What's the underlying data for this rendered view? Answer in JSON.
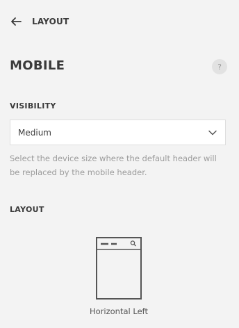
{
  "nav": {
    "back_icon": "arrow-left-icon",
    "back_label": "LAYOUT"
  },
  "section": {
    "title": "MOBILE",
    "help_symbol": "?"
  },
  "visibility": {
    "label": "VISIBILITY",
    "selected": "Medium",
    "chevron_icon": "chevron-down-icon",
    "help_text": "Select the device size where the default header will be replaced by the mobile header."
  },
  "layout": {
    "label": "LAYOUT",
    "options": [
      {
        "label": "Horizontal Left",
        "icon": "horizontal-left-layout-icon"
      }
    ]
  }
}
